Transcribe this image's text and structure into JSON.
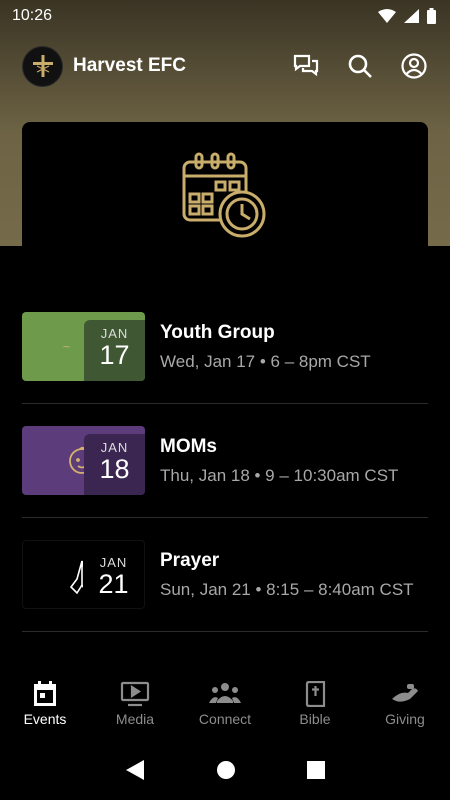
{
  "status": {
    "time": "10:26"
  },
  "app": {
    "title": "Harvest EFC"
  },
  "events": [
    {
      "title": "Youth Group",
      "time": "Wed, Jan 17 • 6 – 8pm CST",
      "month": "JAN",
      "day": "17",
      "thumb_color": "#6e9a4c"
    },
    {
      "title": "MOMs",
      "time": "Thu, Jan 18 • 9 – 10:30am CST",
      "month": "JAN",
      "day": "18",
      "thumb_color": "#5d3c7c"
    },
    {
      "title": "Prayer",
      "time": "Sun, Jan 21 • 8:15 – 8:40am CST",
      "month": "JAN",
      "day": "21",
      "thumb_color": "#000000"
    }
  ],
  "nav": [
    {
      "label": "Events",
      "icon": "calendar-icon",
      "active": true
    },
    {
      "label": "Media",
      "icon": "video-icon"
    },
    {
      "label": "Connect",
      "icon": "people-icon"
    },
    {
      "label": "Bible",
      "icon": "bible-icon"
    },
    {
      "label": "Giving",
      "icon": "giving-hand-icon"
    }
  ],
  "colors": {
    "accent": "#c9ad6b",
    "hero": "#756a49"
  }
}
